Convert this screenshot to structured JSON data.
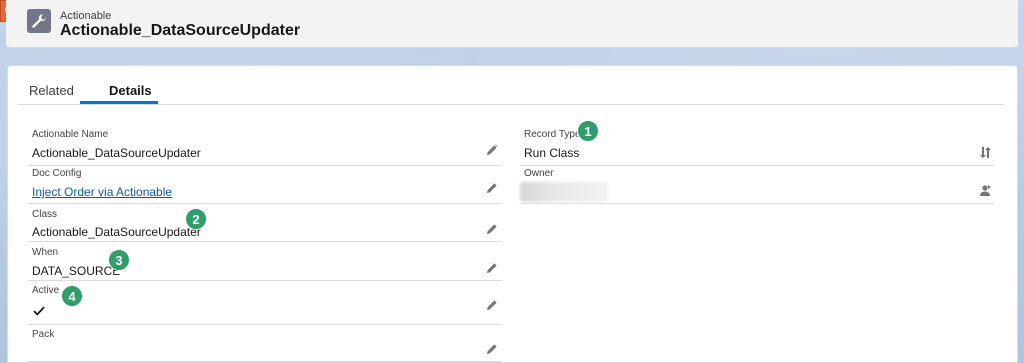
{
  "header": {
    "object_type": "Actionable",
    "title": "Actionable_DataSourceUpdater"
  },
  "tabs": [
    {
      "label": "Related",
      "selected": false
    },
    {
      "label": "Details",
      "selected": true
    }
  ],
  "left_fields": [
    {
      "label": "Actionable Name",
      "value": "Actionable_DataSourceUpdater"
    },
    {
      "label": "Doc Config",
      "value": "Inject Order via Actionable"
    },
    {
      "label": "Class",
      "value": "Actionable_DataSourceUpdater"
    },
    {
      "label": "When",
      "value": "DATA_SOURCE"
    },
    {
      "label": "Active",
      "value": "checked"
    },
    {
      "label": "Pack",
      "value": ""
    }
  ],
  "right_fields": [
    {
      "label": "Record Type",
      "value": "Run Class"
    },
    {
      "label": "Owner",
      "value": ""
    }
  ],
  "badges": [
    "1",
    "2",
    "3",
    "4"
  ],
  "icons": {
    "search": "search-icon",
    "object": "wrench-icon",
    "edit": "pencil-icon",
    "change_record_type": "swap-icon",
    "change_owner": "person-swap-icon",
    "active_check": "checkmark-icon"
  },
  "colors": {
    "accent": "#0176d3",
    "link": "#0b5cab",
    "badge": "#2e9e6b",
    "orange_tab": "#e8673a"
  }
}
